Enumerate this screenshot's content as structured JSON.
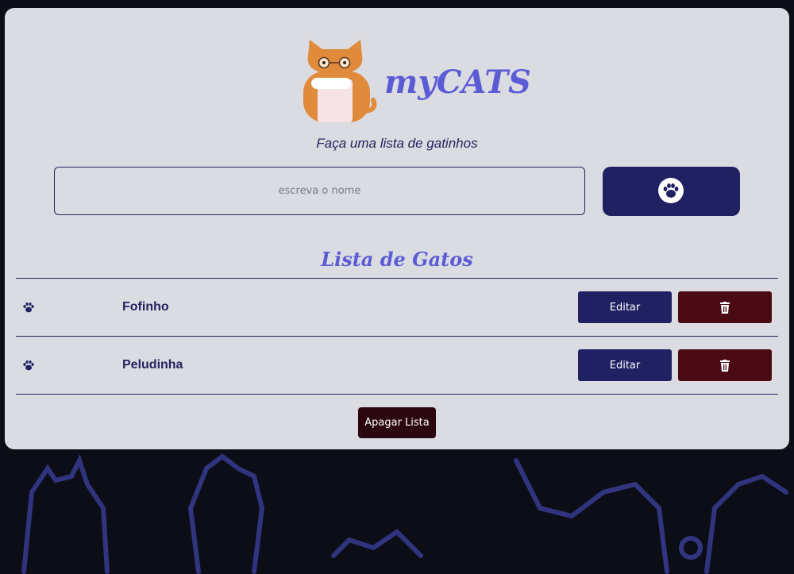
{
  "app": {
    "brand": "myCATS",
    "subtitle": "Faça uma lista de gatinhos"
  },
  "form": {
    "placeholder": "escreva o nome",
    "add_icon": "paw-icon"
  },
  "list": {
    "title": "Lista de Gatos",
    "items": [
      {
        "name": "Fofinho",
        "edit_label": "Editar",
        "delete_icon": "trash-icon"
      },
      {
        "name": "Peludinha",
        "edit_label": "Editar",
        "delete_icon": "trash-icon"
      }
    ],
    "clear_label": "Apagar Lista"
  },
  "colors": {
    "brand_accent": "#5b5bd6",
    "primary_navy": "#1f2163",
    "danger_maroon": "#4a0a14",
    "clear_button": "#2b0710",
    "page_background": "#0d0d18"
  }
}
